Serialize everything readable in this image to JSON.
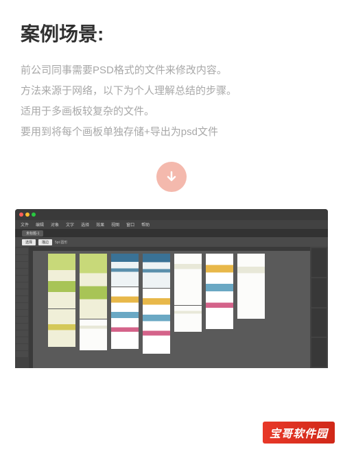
{
  "title": "案例场景:",
  "description": {
    "line1": "前公司同事需要PSD格式的文件来修改内容。",
    "line2": "方法来源于网络，以下为个人理解总结的步骤。",
    "line3": "适用于多画板较复杂的文件。",
    "line4": "要用到将每个画板单独存储+导出为psd文件"
  },
  "app": {
    "menus": [
      "文件",
      "编辑",
      "对象",
      "文字",
      "选择",
      "效果",
      "视图",
      "窗口",
      "帮助"
    ],
    "tab": "未标题-1",
    "options": {
      "sel1": "选择",
      "sel2": "描边",
      "txt": "5pt 圆形"
    }
  },
  "watermark": "宝哥软件园"
}
